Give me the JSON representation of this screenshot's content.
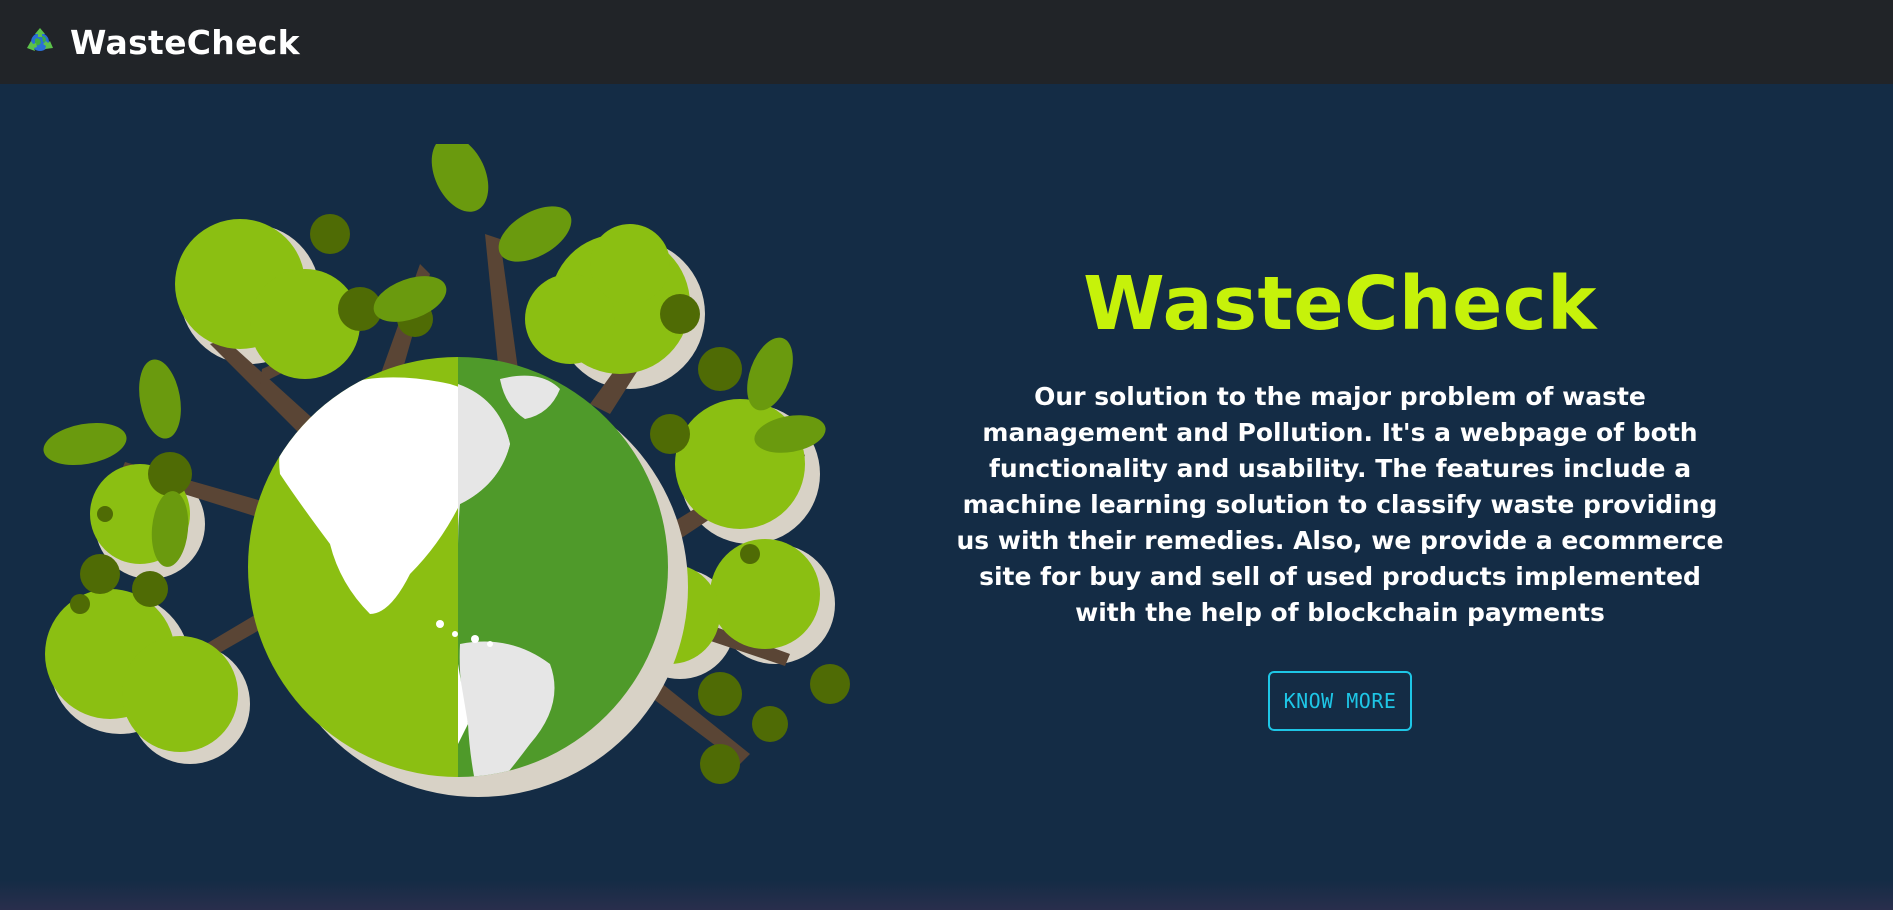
{
  "navbar": {
    "brand_name": "WasteCheck",
    "logo_icon": "recycle-globe-icon"
  },
  "hero": {
    "title": "WasteCheck",
    "description": "Our solution to the major problem of waste management and Pollution. It's a webpage of both functionality and usability. The features include a machine learning solution to classify waste providing us with their remedies. Also, we provide a ecommerce site for buy and sell of used products implemented with the help of blockchain payments",
    "cta_label": "KNOW MORE",
    "illustration": "earth-with-trees-illustration"
  },
  "colors": {
    "navbar_bg": "#212428",
    "page_bg": "#142c45",
    "title": "#c6f20a",
    "cta": "#1ec6e6",
    "leaf_light": "#8bbf12",
    "leaf_dark": "#4f6b05",
    "earth_green": "#4f9a2a",
    "trunk": "#5a4535"
  }
}
